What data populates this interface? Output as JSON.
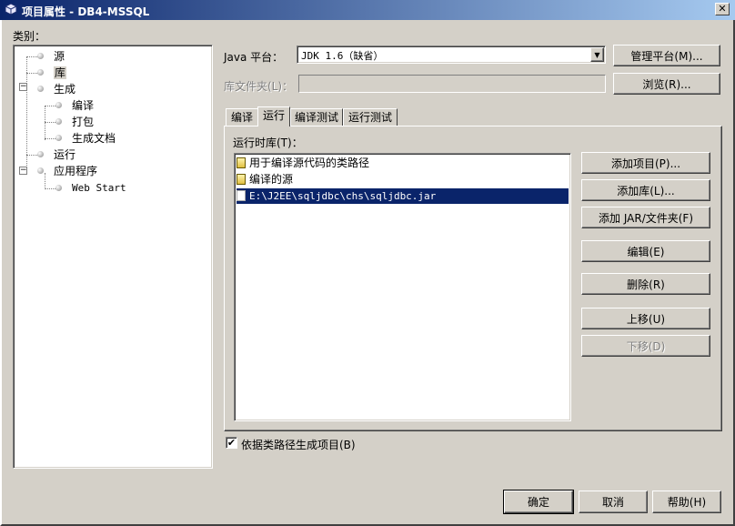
{
  "window": {
    "title": "项目属性 - DB4-MSSQL",
    "close_glyph": "✕"
  },
  "categories": {
    "label": "类别：",
    "items": [
      {
        "label": "源"
      },
      {
        "label": "库"
      },
      {
        "label": "生成"
      },
      {
        "label": "编译"
      },
      {
        "label": "打包"
      },
      {
        "label": "生成文档"
      },
      {
        "label": "运行"
      },
      {
        "label": "应用程序"
      },
      {
        "label": "Web Start"
      }
    ],
    "selected": "库"
  },
  "platform": {
    "label": "Java 平台：",
    "value": "JDK 1.6（缺省）",
    "manage_button": "管理平台(M)..."
  },
  "library_folder": {
    "label": "库文件夹(L)：",
    "value": "",
    "browse_button": "浏览(R)..."
  },
  "tabs": [
    {
      "label": "编译"
    },
    {
      "label": "运行"
    },
    {
      "label": "编译测试"
    },
    {
      "label": "运行测试"
    }
  ],
  "active_tab": "运行",
  "runtime_libraries": {
    "label": "运行时库(T)：",
    "items": [
      {
        "label": "用于编译源代码的类路径",
        "icon": "classpath-icon"
      },
      {
        "label": "编译的源",
        "icon": "classpath-icon"
      },
      {
        "label": "E:\\J2EE\\sqljdbc\\chs\\sqljdbc.jar",
        "icon": "jar-icon",
        "selected": true
      }
    ]
  },
  "list_buttons": {
    "add_project": "添加项目(P)...",
    "add_library": "添加库(L)...",
    "add_jar": "添加 JAR/文件夹(F)",
    "edit": "编辑(E)",
    "remove": "删除(R)",
    "move_up": "上移(U)",
    "move_down": "下移(D)"
  },
  "build_checkbox": {
    "label": "依据类路径生成项目(B)",
    "checked": true,
    "check_glyph": "✔"
  },
  "footer": {
    "ok": "确定",
    "cancel": "取消",
    "help": "帮助(H)"
  },
  "colors": {
    "title_bar": "#0a246a",
    "window_bg": "#d4d0c8",
    "selection": "#0a246a"
  }
}
